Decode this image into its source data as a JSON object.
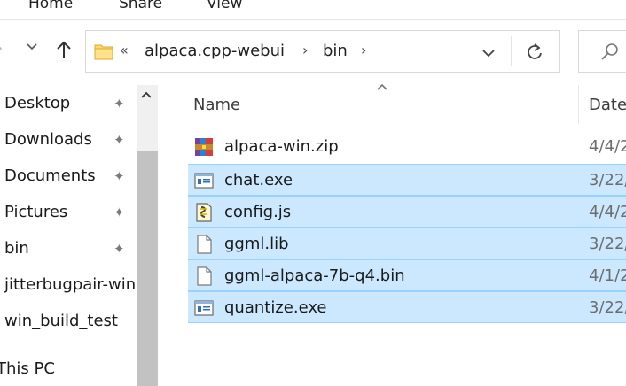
{
  "ribbon": {
    "tabs": [
      "Home",
      "Share",
      "View"
    ]
  },
  "nav": {
    "back_icon": "arrow-left-icon",
    "recent_icon": "chevron-down-icon",
    "up_icon": "arrow-up-icon"
  },
  "address_bar": {
    "overflow": "«",
    "crumbs": [
      "alpaca.cpp-webui",
      "bin"
    ],
    "separator": "›",
    "dropdown_icon": "chevron-down-icon",
    "refresh_icon": "refresh-icon"
  },
  "search": {
    "icon": "search-icon"
  },
  "sidebar": {
    "items": [
      {
        "label": "Desktop",
        "pinned": true
      },
      {
        "label": "Downloads",
        "pinned": true
      },
      {
        "label": "Documents",
        "pinned": true
      },
      {
        "label": "Pictures",
        "pinned": true
      },
      {
        "label": "bin",
        "pinned": true
      },
      {
        "label": "jitterbugpair-win",
        "pinned": false
      },
      {
        "label": "win_build_test",
        "pinned": false
      },
      {
        "label": "This PC",
        "pinned": false
      }
    ],
    "pin_glyph": "📌",
    "scroll_up_glyph": "^"
  },
  "file_list": {
    "columns": {
      "name": "Name",
      "date": "Date"
    },
    "sort_glyph": "^",
    "files": [
      {
        "name": "alpaca-win.zip",
        "date": "4/4/2",
        "type": "zip",
        "selected": false
      },
      {
        "name": "chat.exe",
        "date": "3/22/",
        "type": "exe",
        "selected": true
      },
      {
        "name": "config.js",
        "date": "4/4/2",
        "type": "js",
        "selected": true
      },
      {
        "name": "ggml.lib",
        "date": "3/22/",
        "type": "file",
        "selected": true
      },
      {
        "name": "ggml-alpaca-7b-q4.bin",
        "date": "4/1/2",
        "type": "file",
        "selected": true
      },
      {
        "name": "quantize.exe",
        "date": "3/22/",
        "type": "exe",
        "selected": true
      }
    ]
  },
  "colors": {
    "selection_bg": "#cce8ff",
    "selection_border": "#99d1ff",
    "folder_yellow": "#ffd96b"
  }
}
